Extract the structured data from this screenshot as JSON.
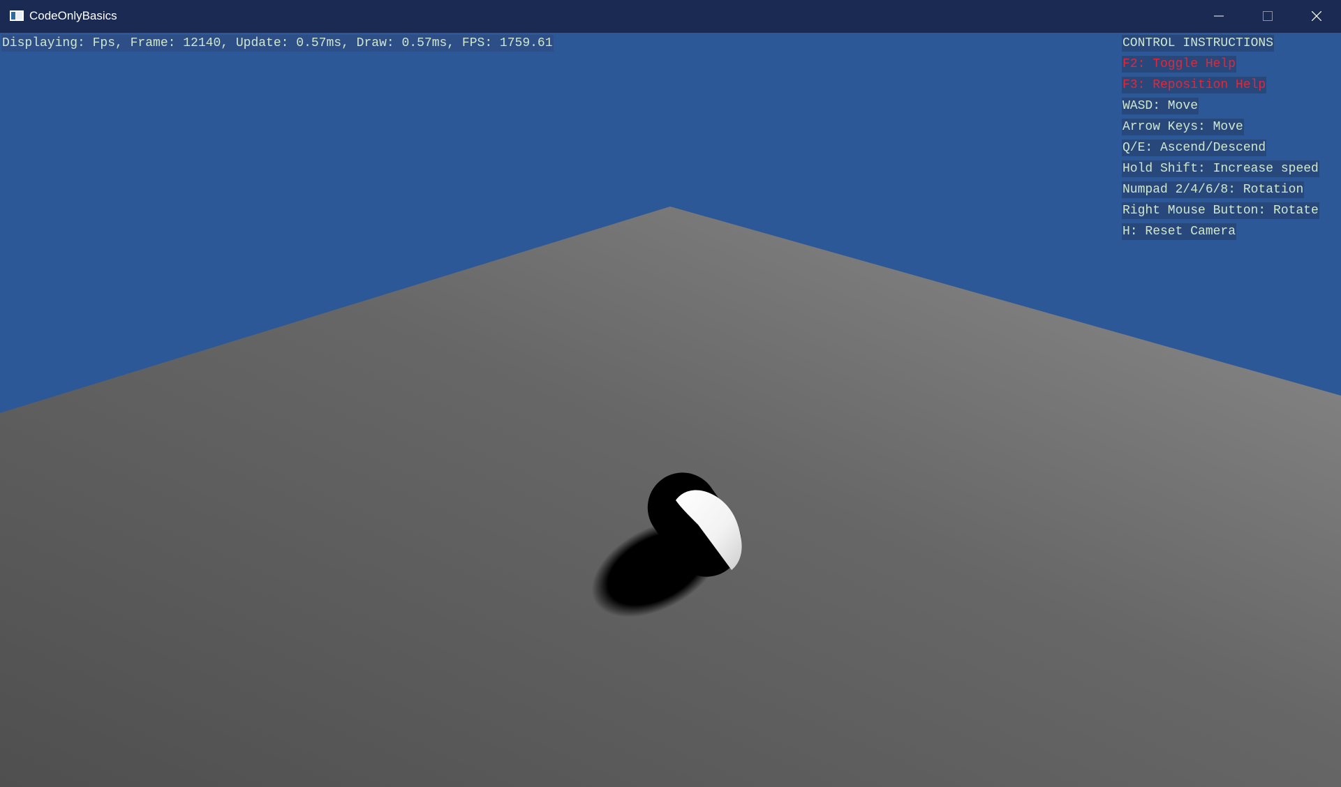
{
  "window": {
    "title": "CodeOnlyBasics",
    "icon": "app-window-icon",
    "controls": {
      "minimize_icon": "minimize-icon",
      "maximize_icon": "maximize-icon",
      "close_icon": "close-icon"
    }
  },
  "stats": {
    "text": "Displaying: Fps, Frame: 12140, Update: 0.57ms, Draw: 0.57ms, FPS: 1759.61"
  },
  "help": {
    "title": "CONTROL INSTRUCTIONS",
    "lines": [
      {
        "text": "F2: Toggle Help",
        "alert": true
      },
      {
        "text": "F3: Reposition Help",
        "alert": true
      },
      {
        "text": "WASD: Move",
        "alert": false
      },
      {
        "text": "Arrow Keys: Move",
        "alert": false
      },
      {
        "text": "Q/E: Ascend/Descend",
        "alert": false
      },
      {
        "text": "Hold Shift: Increase speed",
        "alert": false
      },
      {
        "text": "Numpad 2/4/6/8: Rotation",
        "alert": false
      },
      {
        "text": "Right Mouse Button: Rotate",
        "alert": false
      },
      {
        "text": "H: Reset Camera",
        "alert": false
      }
    ]
  },
  "colors": {
    "titlebar": "#1b2a52",
    "sky": "#2d5897",
    "ground_dark": "#555555",
    "ground_light": "#8a8a8a",
    "hud_text": "#cfe6cf",
    "alert_text": "#e0283a"
  }
}
